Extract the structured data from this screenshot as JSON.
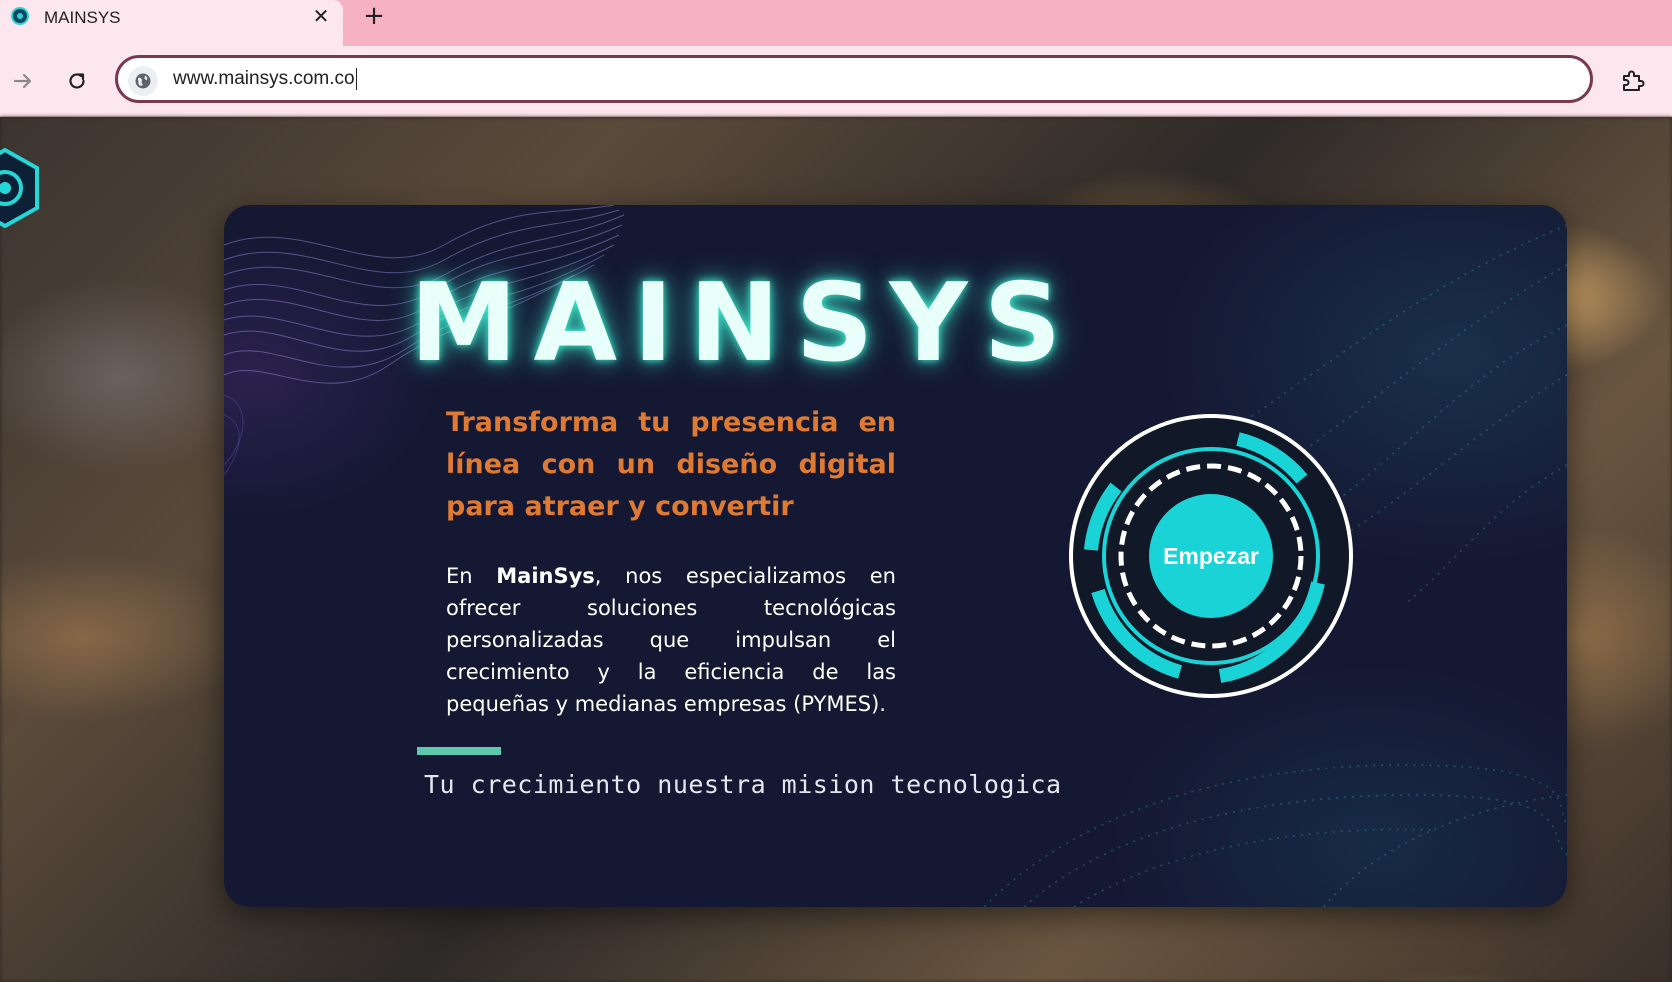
{
  "browser": {
    "tab": {
      "title": "MAINSYS"
    },
    "address_bar": {
      "url": "www.mainsys.com.co"
    }
  },
  "page": {
    "brand": "MAINSYS",
    "headline": "Transforma tu presencia en línea con un diseño digital para atraer y convertir",
    "intro": {
      "prefix": "En ",
      "brand_bold": "MainSys",
      "suffix": ", nos especializamos en ofrecer soluciones tecnológicas personalizadas que impulsan el crecimiento y la eficiencia de las pequeñas y medianas empresas (PYMES)."
    },
    "tagline": "Tu crecimiento nuestra mision tecnologica",
    "cta_label": "Empezar"
  },
  "colors": {
    "tab_strip": "#f6b1c3",
    "toolbar": "#fde7ee",
    "omnibox_border": "#7a3a4e",
    "card_background": "#151833",
    "brand_glow": "#40ffdc",
    "headline": "#df7a32",
    "accent_bar": "#5ec9ad",
    "cta": "#19d3d6"
  },
  "icons": {
    "back": "arrow-right-icon",
    "reload": "reload-icon",
    "site_info": "globe-icon",
    "extensions": "puzzle-icon",
    "close_tab": "close-icon",
    "new_tab": "plus-icon"
  }
}
